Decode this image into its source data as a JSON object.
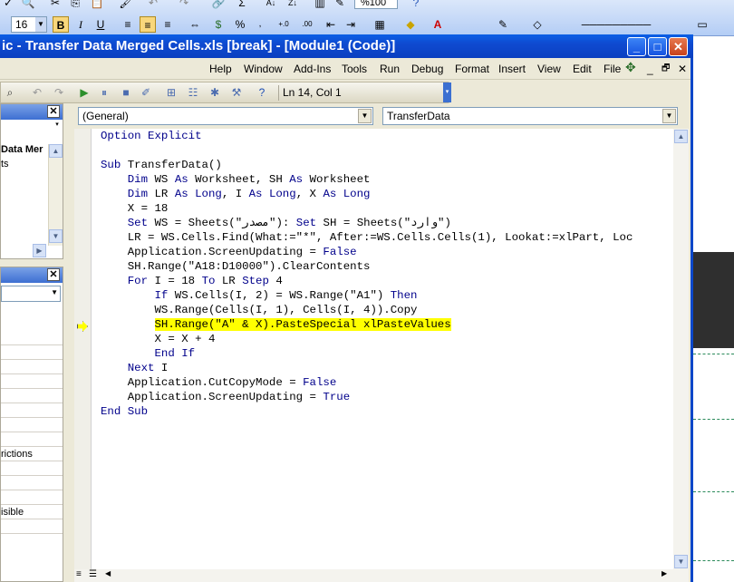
{
  "excel_toolbar": {
    "font_size": "16",
    "zoom": "%100"
  },
  "window": {
    "title": "ic - Transfer Data Merged Cells.xls [break] - [Module1 (Code)]",
    "minimize": "_",
    "maximize": "□",
    "close": "✕"
  },
  "menu": {
    "items": [
      "Help",
      "Window",
      "Add-Ins",
      "Tools",
      "Run",
      "Debug",
      "Format",
      "Insert",
      "View",
      "Edit",
      "File"
    ],
    "doc_min": "_",
    "doc_restore": "🗗",
    "doc_close": "✕"
  },
  "toolbar": {
    "position": "Ln 14, Col 1"
  },
  "project_panel": {
    "item1": "Data Mer",
    "item2": "ts"
  },
  "properties_panel": {
    "row_text_1": "rictions",
    "row_text_2": "isible"
  },
  "code_window": {
    "object_combo": "(General)",
    "proc_combo": "TransferData"
  },
  "code_lines": [
    "Option Explicit",
    "",
    "Sub TransferData()",
    "    Dim WS As Worksheet, SH As Worksheet",
    "    Dim LR As Long, I As Long, X As Long",
    "    X = 18",
    "    Set WS = Sheets(\"مصدر\"): Set SH = Sheets(\"وارد\")",
    "    LR = WS.Cells.Find(What:=\"*\", After:=WS.Cells.Cells(1), Lookat:=xlPart, Loc",
    "    Application.ScreenUpdating = False",
    "    SH.Range(\"A18:D10000\").ClearContents",
    "    For I = 18 To LR Step 4",
    "        If WS.Cells(I, 2) = WS.Range(\"A1\") Then",
    "        WS.Range(Cells(I, 1), Cells(I, 4)).Copy",
    "        SH.Range(\"A\" & X).PasteSpecial xlPasteValues",
    "        X = X + 4",
    "        End If",
    "    Next I",
    "    Application.CutCopyMode = False",
    "    Application.ScreenUpdating = True",
    "End Sub"
  ],
  "highlight_line": 13,
  "colors": {
    "keyword": "#00008b",
    "highlight": "#ffff00",
    "titlebar": "#0a4fd6"
  }
}
